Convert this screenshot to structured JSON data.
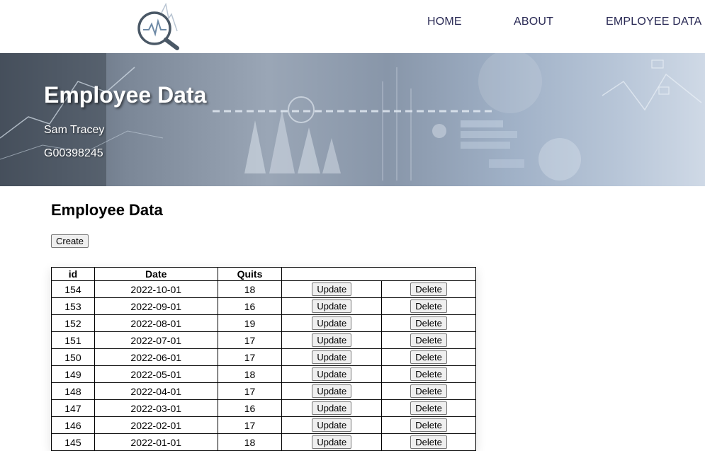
{
  "nav": {
    "logo_icon": "magnifier-chart-icon",
    "links": [
      "HOME",
      "ABOUT",
      "EMPLOYEE DATA"
    ]
  },
  "hero": {
    "title": "Employee Data",
    "name": "Sam Tracey",
    "student_id": "G00398245"
  },
  "main": {
    "heading": "Employee Data",
    "create_label": "Create",
    "table": {
      "headers": [
        "id",
        "Date",
        "Quits",
        ""
      ],
      "update_label": "Update",
      "delete_label": "Delete",
      "rows": [
        {
          "id": "154",
          "date": "2022-10-01",
          "quits": "18"
        },
        {
          "id": "153",
          "date": "2022-09-01",
          "quits": "16"
        },
        {
          "id": "152",
          "date": "2022-08-01",
          "quits": "19"
        },
        {
          "id": "151",
          "date": "2022-07-01",
          "quits": "17"
        },
        {
          "id": "150",
          "date": "2022-06-01",
          "quits": "17"
        },
        {
          "id": "149",
          "date": "2022-05-01",
          "quits": "18"
        },
        {
          "id": "148",
          "date": "2022-04-01",
          "quits": "17"
        },
        {
          "id": "147",
          "date": "2022-03-01",
          "quits": "16"
        },
        {
          "id": "146",
          "date": "2022-02-01",
          "quits": "17"
        },
        {
          "id": "145",
          "date": "2022-01-01",
          "quits": "18"
        }
      ]
    }
  }
}
